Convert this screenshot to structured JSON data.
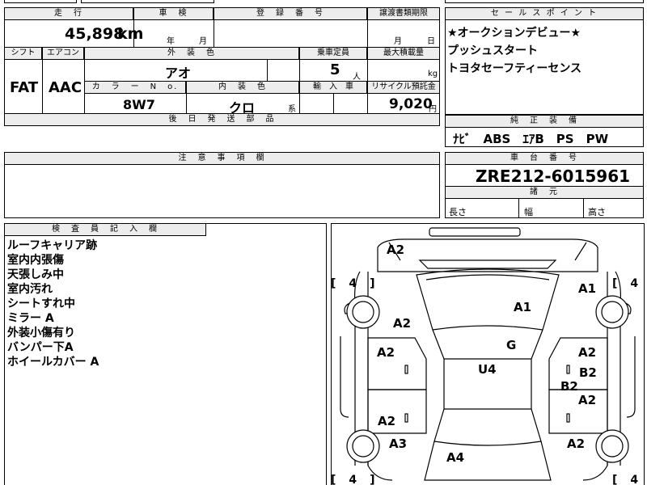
{
  "top_cut": {
    "left": "",
    "center": "",
    "right": ""
  },
  "headers": {
    "mileage": "走　行",
    "inspection": "車　検",
    "registration": "登　録　番　号",
    "transfer": "譲渡書類期限",
    "shift": "シフト",
    "aircon": "エアコン",
    "exterior_color": "外　装　色",
    "capacity": "乗車定員",
    "max_load": "最大積載量",
    "color_no": "カ　ラ　ー　N　o.",
    "interior_color": "内　装　色",
    "import": "輸　入　車",
    "recycle": "リサイクル預託金",
    "later_parts": "後　日　発　送　部　品",
    "sales_point": "セ ー ル ス ポ イ ン ト",
    "genuine_equipment": "純　正　装　備",
    "notes": "注　意　事　項　欄",
    "chassis_number": "車　台　番　号",
    "dimensions": "諸　元",
    "inspector": "検　査　員　記　入　欄"
  },
  "values": {
    "mileage": "45,898",
    "mileage_unit": "km",
    "inspection_year": "年",
    "inspection_month": "月",
    "transfer_month": "月",
    "transfer_day": "日",
    "shift": "FAT",
    "aircon": "AAC",
    "exterior_color": "アオ",
    "capacity": "5",
    "capacity_unit": "人",
    "max_load_unit": "kg",
    "color_no": "8W7",
    "interior_color": "クロ",
    "interior_suffix": "系",
    "recycle": "9,020",
    "recycle_unit": "円",
    "genuine_equipment": "ﾅﾋﾞ　ABS　ｴｱB　PS　PW",
    "chassis_number": "ZRE212-6015961",
    "length_label": "長さ",
    "width_label": "幅",
    "height_label": "高さ"
  },
  "sales_points": [
    "★オークションデビュー★",
    "プッシュスタート",
    "トヨタセーフティーセンス"
  ],
  "inspector_notes": [
    "ルーフキャリア跡",
    "室内内張傷",
    "天張しみ中",
    "室内汚れ",
    "シートすれ中",
    "ミラー A",
    "外装小傷有り",
    "バンパー下A",
    "ホイールカバー A"
  ],
  "diagram": {
    "tire_marks": [
      "[　4　]",
      "[　4　]",
      "[　4　]",
      "[　4　]"
    ],
    "damage_codes": [
      "A2",
      "A1",
      "A1",
      "A2",
      "G",
      "A2",
      "U4",
      "A2",
      "B2",
      "B2",
      "A2",
      "A2",
      "A3",
      "A2",
      "A4"
    ]
  }
}
